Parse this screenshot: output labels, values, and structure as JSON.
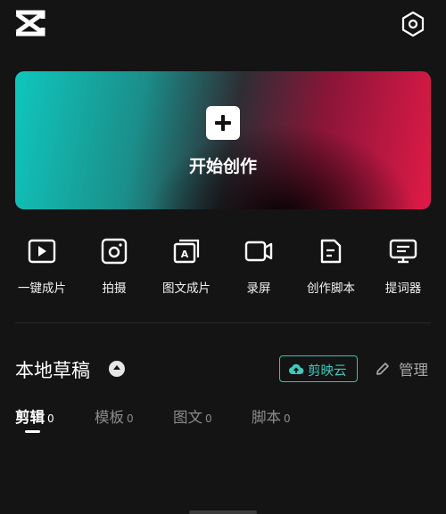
{
  "app": {
    "brand_color": "#3ecabc",
    "background": "#141414"
  },
  "topbar": {
    "logo_icon": "capcut-logo-icon",
    "settings_icon": "settings-hexagon-icon"
  },
  "hero": {
    "label": "开始创作",
    "icon": "plus-icon"
  },
  "tools": [
    {
      "label": "一键成片",
      "icon": "play-video-icon"
    },
    {
      "label": "拍摄",
      "icon": "camera-icon"
    },
    {
      "label": "图文成片",
      "icon": "image-text-icon"
    },
    {
      "label": "录屏",
      "icon": "screen-record-icon"
    },
    {
      "label": "创作脚本",
      "icon": "script-doc-icon"
    },
    {
      "label": "提词器",
      "icon": "teleprompter-icon"
    }
  ],
  "drafts": {
    "title": "本地草稿",
    "cloud_label": "剪映云",
    "manage_label": "管理",
    "tabs": [
      {
        "label": "剪辑",
        "count": "0",
        "active": true
      },
      {
        "label": "模板",
        "count": "0",
        "active": false
      },
      {
        "label": "图文",
        "count": "0",
        "active": false
      },
      {
        "label": "脚本",
        "count": "0",
        "active": false
      }
    ]
  }
}
